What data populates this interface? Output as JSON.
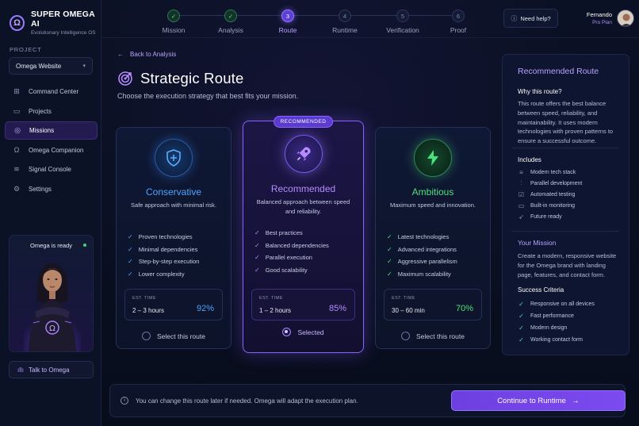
{
  "brand": {
    "name": "SUPER OMEGA AI",
    "subtitle": "Evolutionary Intelligence OS",
    "logo_glyph": "Ω"
  },
  "sidebar": {
    "project_label": "PROJECT",
    "project_value": "Omega Website",
    "items": [
      {
        "label": "Command Center",
        "icon": "command-center-icon"
      },
      {
        "label": "Projects",
        "icon": "folder-icon"
      },
      {
        "label": "Missions",
        "icon": "target-icon",
        "active": true
      },
      {
        "label": "Omega Companion",
        "icon": "omega-icon"
      },
      {
        "label": "Signal Console",
        "icon": "signal-icon"
      },
      {
        "label": "Settings",
        "icon": "gear-icon"
      }
    ],
    "omega_status": "Omega is ready",
    "talk_button": "Talk to Omega"
  },
  "stepper": {
    "steps": [
      {
        "label": "Mission",
        "state": "done",
        "glyph": "✓"
      },
      {
        "label": "Analysis",
        "state": "done",
        "glyph": "✓"
      },
      {
        "label": "Route",
        "state": "current",
        "glyph": "3"
      },
      {
        "label": "Runtime",
        "state": "pending",
        "glyph": "4"
      },
      {
        "label": "Verification",
        "state": "pending",
        "glyph": "5"
      },
      {
        "label": "Proof",
        "state": "pending",
        "glyph": "6"
      }
    ]
  },
  "header": {
    "help_label": "Need help?",
    "user_name": "Fernando",
    "user_plan": "Pro Plan"
  },
  "main": {
    "back_label": "Back to Analysis",
    "title": "Strategic Route",
    "subtitle": "Choose the execution strategy that best fits your mission.",
    "cards": [
      {
        "title": "Conservative",
        "accent": "#4da3ff",
        "desc": "Safe approach with minimal risk.",
        "features": [
          "Proven technologies",
          "Minimal dependencies",
          "Step-by-step execution",
          "Lower complexity"
        ],
        "est_label": "EST. TIME",
        "est_time": "2 – 3 hours",
        "confidence": "92%",
        "select_label": "Select this route"
      },
      {
        "badge": "RECOMMENDED",
        "title": "Recommended",
        "accent": "#b58bff",
        "desc": "Balanced approach between speed and reliability.",
        "features": [
          "Best practices",
          "Balanced dependencies",
          "Parallel execution",
          "Good scalability"
        ],
        "est_label": "EST. TIME",
        "est_time": "1 – 2 hours",
        "confidence": "85%",
        "select_label": "Selected"
      },
      {
        "title": "Ambitious",
        "accent": "#4ee07a",
        "desc": "Maximum speed and innovation.",
        "features": [
          "Latest technologies",
          "Advanced integrations",
          "Aggressive parallelism",
          "Maximum scalability"
        ],
        "est_label": "EST. TIME",
        "est_time": "30 – 60 min",
        "confidence": "70%",
        "select_label": "Select this route"
      }
    ],
    "footer_note": "You can change this route later if needed.  Omega will adapt the execution plan.",
    "continue_label": "Continue to Runtime"
  },
  "right_panel": {
    "title": "Recommended Route",
    "why_title": "Why this route?",
    "why_text": "This route offers the best balance between speed, reliability, and maintainability. It uses modern technologies with proven patterns to ensure a successful outcome.",
    "includes_title": "Includes",
    "includes": [
      {
        "label": "Modern tech stack",
        "icon": "layers-icon"
      },
      {
        "label": "Parallel development",
        "icon": "parallel-icon"
      },
      {
        "label": "Automated testing",
        "icon": "checkbox-icon"
      },
      {
        "label": "Built-in monitoring",
        "icon": "monitor-icon"
      },
      {
        "label": "Future ready",
        "icon": "rocket-icon"
      }
    ],
    "mission_title": "Your Mission",
    "mission_text": "Create a modern, responsive website for the Omega brand with landing page, features, and contact form.",
    "criteria_title": "Success Criteria",
    "criteria": [
      "Responsive on all devices",
      "Fast performance",
      "Modern design",
      "Working contact form"
    ]
  }
}
